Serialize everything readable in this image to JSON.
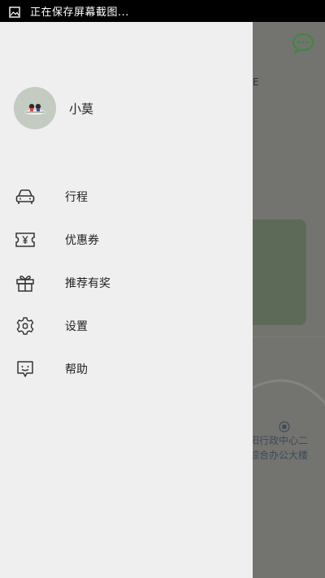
{
  "status_bar": {
    "notification_text": "正在保存屏幕截图..."
  },
  "drawer": {
    "profile": {
      "username": "小莫"
    },
    "menu": {
      "items": [
        {
          "label": "行程",
          "icon": "car-icon"
        },
        {
          "label": "优惠券",
          "icon": "coupon-icon"
        },
        {
          "label": "推荐有奖",
          "icon": "gift-icon"
        },
        {
          "label": "设置",
          "icon": "gear-icon"
        },
        {
          "label": "帮助",
          "icon": "help-icon"
        }
      ]
    }
  },
  "map": {
    "poi_label_line1": "阳行政中心二",
    "poi_label_line2": "综合办公大楼",
    "edge_text": "E"
  },
  "colors": {
    "drawer_background": "#efefef",
    "overlay": "#6f6f69",
    "accent_green": "#3a8a3a",
    "icon_stroke": "#333333"
  }
}
